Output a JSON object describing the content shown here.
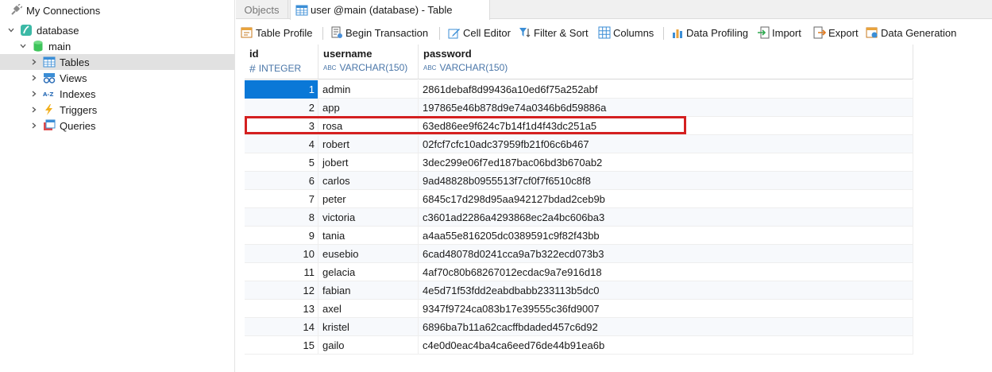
{
  "sidebar": {
    "connections_label": "My Connections",
    "database_label": "database",
    "schema_label": "main",
    "items": [
      {
        "label": "Tables"
      },
      {
        "label": "Views"
      },
      {
        "label": "Indexes"
      },
      {
        "label": "Triggers"
      },
      {
        "label": "Queries"
      }
    ]
  },
  "tabs": {
    "objects_label": "Objects",
    "active_label": "user @main (database) - Table"
  },
  "toolbar": {
    "table_profile": "Table Profile",
    "begin_transaction": "Begin Transaction",
    "cell_editor": "Cell Editor",
    "filter_sort": "Filter & Sort",
    "columns": "Columns",
    "data_profiling": "Data Profiling",
    "import": "Import",
    "export": "Export",
    "data_generation": "Data Generation"
  },
  "grid": {
    "columns": [
      {
        "name": "id",
        "type": "INTEGER",
        "type_icon": "#"
      },
      {
        "name": "username",
        "type": "VARCHAR(150)",
        "type_icon": "ABC"
      },
      {
        "name": "password",
        "type": "VARCHAR(150)",
        "type_icon": "ABC"
      }
    ],
    "rows": [
      {
        "id": "1",
        "username": "admin",
        "password": "2861debaf8d99436a10ed6f75a252abf"
      },
      {
        "id": "2",
        "username": "app",
        "password": "197865e46b878d9e74a0346b6d59886a"
      },
      {
        "id": "3",
        "username": "rosa",
        "password": "63ed86ee9f624c7b14f1d4f43dc251a5"
      },
      {
        "id": "4",
        "username": "robert",
        "password": "02fcf7cfc10adc37959fb21f06c6b467"
      },
      {
        "id": "5",
        "username": "jobert",
        "password": "3dec299e06f7ed187bac06bd3b670ab2"
      },
      {
        "id": "6",
        "username": "carlos",
        "password": "9ad48828b0955513f7cf0f7f6510c8f8"
      },
      {
        "id": "7",
        "username": "peter",
        "password": "6845c17d298d95aa942127bdad2ceb9b"
      },
      {
        "id": "8",
        "username": "victoria",
        "password": "c3601ad2286a4293868ec2a4bc606ba3"
      },
      {
        "id": "9",
        "username": "tania",
        "password": "a4aa55e816205dc0389591c9f82f43bb"
      },
      {
        "id": "10",
        "username": "eusebio",
        "password": "6cad48078d0241cca9a7b322ecd073b3"
      },
      {
        "id": "11",
        "username": "gelacia",
        "password": "4af70c80b68267012ecdac9a7e916d18"
      },
      {
        "id": "12",
        "username": "fabian",
        "password": "4e5d71f53fdd2eabdbabb233113b5dc0"
      },
      {
        "id": "13",
        "username": "axel",
        "password": "9347f9724ca083b17e39555c36fd9007"
      },
      {
        "id": "14",
        "username": "kristel",
        "password": "6896ba7b11a62cacffbdaded457c6d92"
      },
      {
        "id": "15",
        "username": "gailo",
        "password": "c4e0d0eac4ba4ca6eed76de44b91ea6b"
      }
    ],
    "selected_row_index": 0,
    "highlighted_row_index": 2
  },
  "colors": {
    "selection": "#0a78d7",
    "highlight_border": "#d42020",
    "type_text": "#4a76a8"
  }
}
